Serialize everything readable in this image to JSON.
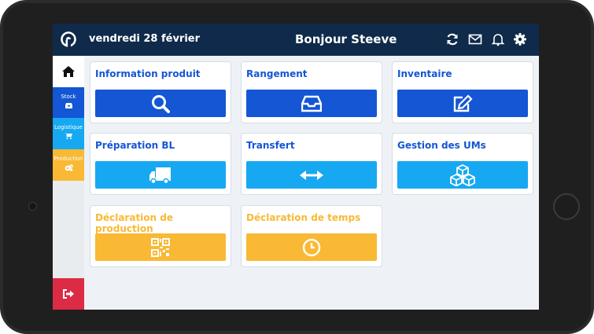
{
  "header": {
    "date": "vendredi 28 février",
    "greeting": "Bonjour Steeve",
    "icons": [
      "logo-icon",
      "refresh-icon",
      "mail-icon",
      "bell-icon",
      "gear-icon"
    ]
  },
  "sidebar": {
    "items": [
      {
        "label": "",
        "icon": "home-icon"
      },
      {
        "label": "Stock",
        "icon": "inbox-icon"
      },
      {
        "label": "Logistique",
        "icon": "cart-icon"
      },
      {
        "label": "Production",
        "icon": "cogs-icon"
      },
      {
        "label": "",
        "icon": "logout-icon"
      }
    ]
  },
  "cards": [
    {
      "title": "Information produit",
      "icon": "search-icon"
    },
    {
      "title": "Rangement",
      "icon": "inbox-icon"
    },
    {
      "title": "Inventaire",
      "icon": "edit-icon"
    },
    {
      "title": "Préparation BL",
      "icon": "truck-icon"
    },
    {
      "title": "Transfert",
      "icon": "arrows-horizontal-icon"
    },
    {
      "title": "Gestion des UMs",
      "icon": "cubes-icon"
    },
    {
      "title": "Déclaration de production",
      "icon": "qrcode-icon"
    },
    {
      "title": "Déclaration de temps",
      "icon": "clock-icon"
    }
  ],
  "colors": {
    "header": "#0f2a4a",
    "primary": "#1456d4",
    "info": "#17a8f2",
    "warning": "#f9b934",
    "danger": "#dc2b44"
  }
}
